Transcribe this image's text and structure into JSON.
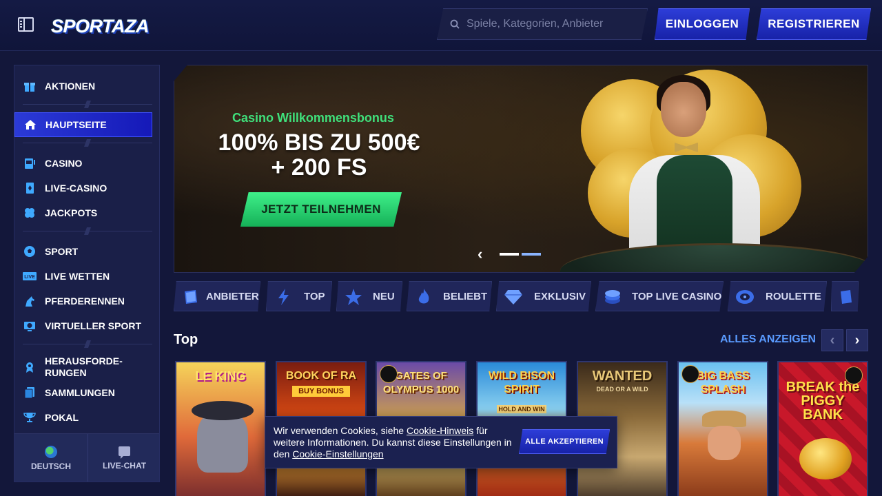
{
  "header": {
    "logo_text": "SPORTAZA",
    "search_placeholder": "Spiele, Kategorien, Anbieter",
    "login_label": "EINLOGGEN",
    "register_label": "REGISTRIEREN"
  },
  "sidebar": {
    "items": [
      {
        "label": "AKTIONEN",
        "icon": "gift-icon"
      },
      {
        "label": "HAUPTSEITE",
        "icon": "home-icon"
      },
      {
        "label": "CASINO",
        "icon": "slot-machine-icon"
      },
      {
        "label": "LIVE-CASINO",
        "icon": "card-icon"
      },
      {
        "label": "JACKPOTS",
        "icon": "clover-icon"
      },
      {
        "label": "SPORT",
        "icon": "football-icon"
      },
      {
        "label": "LIVE WETTEN",
        "icon": "live-icon"
      },
      {
        "label": "PFERDERENNEN",
        "icon": "horse-icon"
      },
      {
        "label": "VIRTUELLER SPORT",
        "icon": "virtual-sport-icon"
      },
      {
        "label": "HERAUSFORDE-\nRUNGEN",
        "icon": "medal-icon"
      },
      {
        "label": "SAMMLUNGEN",
        "icon": "collections-icon"
      },
      {
        "label": "POKAL",
        "icon": "trophy-icon"
      }
    ],
    "footer": {
      "language_label": "DEUTSCH",
      "chat_label": "LIVE-CHAT"
    }
  },
  "banner": {
    "subtitle": "Casino Willkommensbonus",
    "title_line1": "100% BIS ZU 500€",
    "title_line2": "+ 200 FS",
    "cta_label": "JETZT TEILNEHMEN"
  },
  "categories": [
    {
      "label": "ANBIETER",
      "icon": "book-icon"
    },
    {
      "label": "TOP",
      "icon": "lightning-icon"
    },
    {
      "label": "NEU",
      "icon": "star-icon"
    },
    {
      "label": "BELIEBT",
      "icon": "flame-icon"
    },
    {
      "label": "EXKLUSIV",
      "icon": "diamond-icon"
    },
    {
      "label": "TOP LIVE CASINO",
      "icon": "chips-icon"
    },
    {
      "label": "ROULETTE",
      "icon": "roulette-icon"
    }
  ],
  "section": {
    "title": "Top",
    "see_all_label": "ALLES ANZEIGEN"
  },
  "games": [
    {
      "title": "LE KING",
      "subtitle": ""
    },
    {
      "title": "BOOK OF RA",
      "subtitle": "BUY BONUS"
    },
    {
      "title": "GATES OF OLYMPUS 1000",
      "subtitle": ""
    },
    {
      "title": "WILD BISON SPIRIT",
      "subtitle": "HOLD AND WIN"
    },
    {
      "title": "WANTED",
      "subtitle": "DEAD OR A WILD"
    },
    {
      "title": "BIG BASS SPLASH",
      "subtitle": ""
    },
    {
      "title": "BREAK the PIGGY BANK",
      "subtitle": ""
    }
  ],
  "cookie": {
    "text_before": "Wir verwenden Cookies, siehe ",
    "link1": "Cookie-Hinweis",
    "text_middle": " für weitere Informationen. Du kannst diese Einstellungen in den ",
    "link2": "Cookie-Einstellungen",
    "accept_label": "ALLE AKZEPTIEREN"
  },
  "colors": {
    "accent_blue": "#2b3ad6",
    "accent_green": "#3fe07b",
    "link_blue": "#5a9bff",
    "background": "#13173a"
  }
}
